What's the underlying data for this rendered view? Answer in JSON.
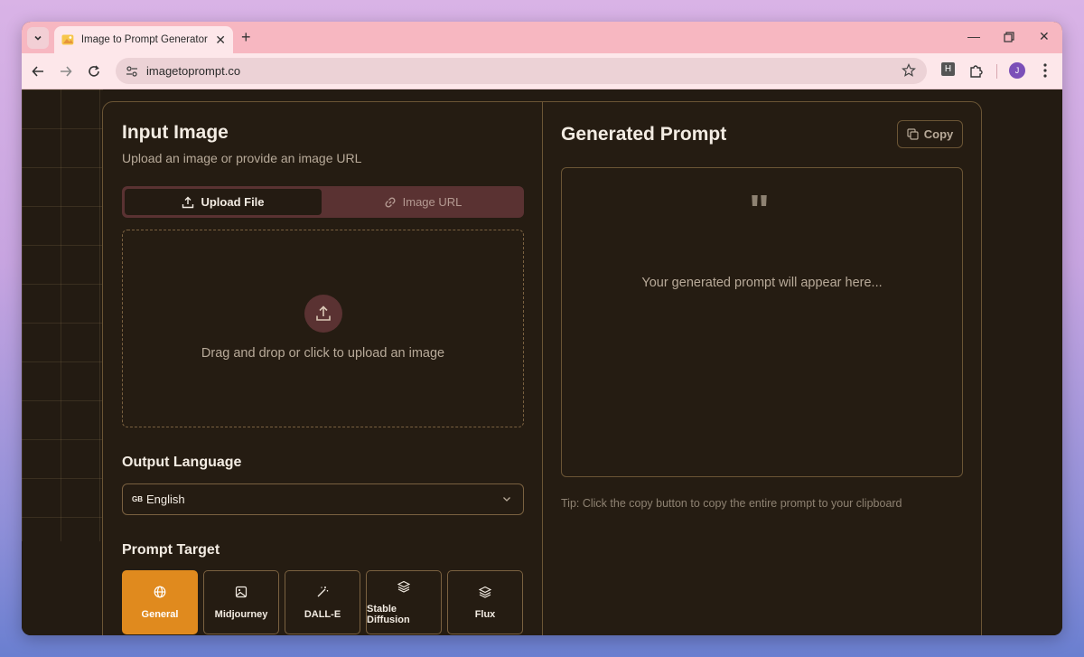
{
  "browser": {
    "tab_title": "Image to Prompt Generator | Tu",
    "url": "imagetoprompt.co",
    "avatar_initial": "J",
    "ext_letter": "H"
  },
  "left": {
    "title": "Input Image",
    "subtitle": "Upload an image or provide an image URL",
    "tabs": [
      {
        "label": "Upload File",
        "active": true
      },
      {
        "label": "Image URL",
        "active": false
      }
    ],
    "dropzone_text": "Drag and drop or click to upload an image",
    "output_language": {
      "label": "Output Language",
      "flag": "GB",
      "value": "English"
    },
    "prompt_target": {
      "label": "Prompt Target",
      "options": [
        {
          "label": "General",
          "icon": "globe-icon",
          "active": true
        },
        {
          "label": "Midjourney",
          "icon": "image-icon",
          "active": false
        },
        {
          "label": "DALL-E",
          "icon": "magic-wand-icon",
          "active": false
        },
        {
          "label": "Stable Diffusion",
          "icon": "layers-icon",
          "active": false
        },
        {
          "label": "Flux",
          "icon": "layers-icon",
          "active": false
        }
      ]
    }
  },
  "right": {
    "title": "Generated Prompt",
    "copy_label": "Copy",
    "quote_mark": "\"",
    "placeholder": "Your generated prompt will appear here...",
    "tip": "Tip: Click the copy button to copy the entire prompt to your clipboard"
  },
  "colors": {
    "accent": "#e08a1e",
    "background": "#231b12",
    "segment_bg": "#5a3232",
    "border": "#6b5535"
  }
}
